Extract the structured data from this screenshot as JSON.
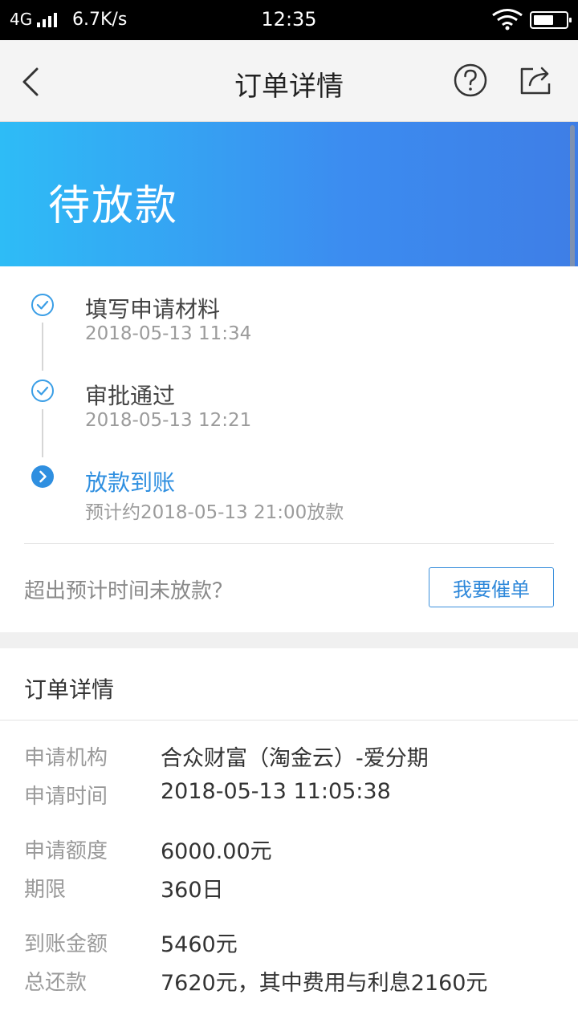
{
  "status_bar": {
    "network": "4G",
    "speed": "6.7K/s",
    "time": "12:35",
    "icons": [
      "signal-icon",
      "wifi-icon",
      "battery-icon"
    ]
  },
  "nav": {
    "title": "订单详情",
    "icons": [
      "back-arrow-icon",
      "help-icon",
      "share-icon"
    ]
  },
  "hero": {
    "status": "待放款",
    "gradient_colors": [
      "#2ebcf6",
      "#3e7ee6"
    ]
  },
  "timeline": {
    "steps": [
      {
        "title": "填写申请材料",
        "time": "2018-05-13 11:34",
        "state": "done"
      },
      {
        "title": "审批通过",
        "time": "2018-05-13 12:21",
        "state": "done"
      },
      {
        "title": "放款到账",
        "time": "预计约2018-05-13 21:00放款",
        "state": "current"
      }
    ],
    "overdue_prompt": "超出预计时间未放款？",
    "urge_button": "我要催单",
    "accent_color": "#2f8fe0"
  },
  "detail": {
    "section_title": "订单详情",
    "rows": [
      {
        "label": "申请机构",
        "value": "合众财富（淘金云）-爱分期"
      },
      {
        "label": "申请时间",
        "value": "2018-05-13 11:05:38"
      },
      {
        "label": "申请额度",
        "value": "6000.00元"
      },
      {
        "label": "期限",
        "value": "360日"
      },
      {
        "label": "到账金额",
        "value": "5460元"
      },
      {
        "label": "总还款",
        "value": "7620元，其中费用与利息2160元"
      }
    ]
  }
}
